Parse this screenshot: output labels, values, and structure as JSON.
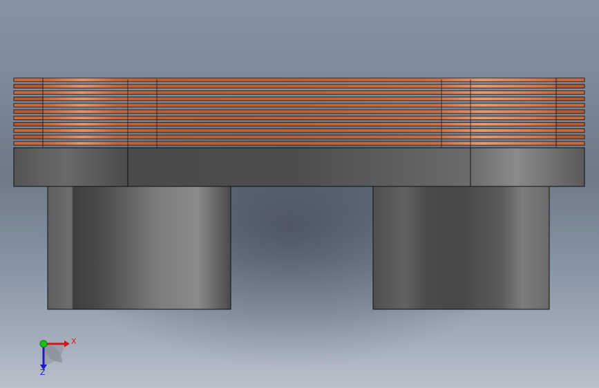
{
  "viewport": {
    "background_top": "#8693a3",
    "background_bottom": "#b8c0cb"
  },
  "model": {
    "components": [
      "copper-winding-laminations",
      "magnetic-core-yoke",
      "left-core-leg",
      "right-core-leg"
    ],
    "colors": {
      "copper_light": "#e8946a",
      "copper_mid": "#c9683c",
      "copper_dark": "#a34e28",
      "steel_light": "#8a8a8a",
      "steel_mid": "#595959",
      "steel_dark": "#3f3f3f",
      "edge": "#111111"
    }
  },
  "triad": {
    "x_label": "X",
    "z_label": "Z",
    "x_color": "#cc1a1a",
    "y_color": "#1fbf1f",
    "z_color": "#1a1acc"
  }
}
